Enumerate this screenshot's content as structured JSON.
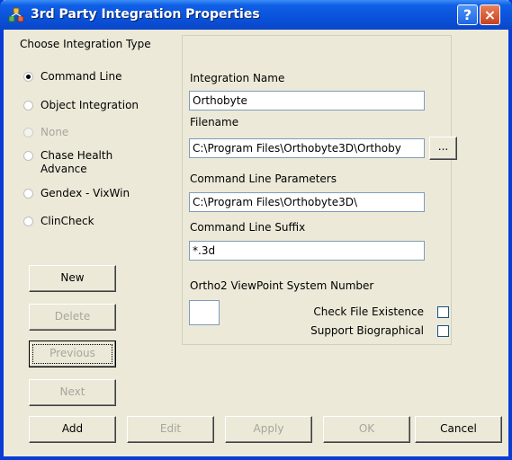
{
  "window": {
    "title": "3rd Party Integration Properties",
    "help_glyph": "?",
    "close_glyph": "×"
  },
  "integration_type": {
    "label": "Choose Integration Type",
    "options": [
      {
        "label": "Command Line",
        "selected": true,
        "enabled": true
      },
      {
        "label": "Object Integration",
        "selected": false,
        "enabled": true
      },
      {
        "label": "None",
        "selected": false,
        "enabled": false
      },
      {
        "label": "Chase Health Advance",
        "selected": false,
        "enabled": true
      },
      {
        "label": "Gendex - VixWin",
        "selected": false,
        "enabled": true
      },
      {
        "label": "ClinCheck",
        "selected": false,
        "enabled": true
      }
    ]
  },
  "side_buttons": {
    "new": "New",
    "delete": "Delete",
    "previous": "Previous",
    "next": "Next"
  },
  "fields": {
    "integration_name_label": "Integration Name",
    "integration_name": "Orthobyte",
    "filename_label": "Filename",
    "filename": "C:\\Program Files\\Orthobyte3D\\Orthoby",
    "browse": "...",
    "cmd_params_label": "Command Line Parameters",
    "cmd_params": "C:\\Program Files\\Orthobyte3D\\",
    "cmd_suffix_label": "Command Line Suffix",
    "cmd_suffix": "*.3d",
    "system_number_label": "Ortho2 ViewPoint System Number",
    "system_number": "",
    "check_file_existence": "Check File Existence",
    "support_biographical": "Support Biographical"
  },
  "bottom_buttons": {
    "add": "Add",
    "edit": "Edit",
    "apply": "Apply",
    "ok": "OK",
    "cancel": "Cancel"
  },
  "colors": {
    "titlebar": "#0a52d9",
    "dialog_bg": "#ece9d8",
    "disabled_text": "#a7a69d"
  }
}
